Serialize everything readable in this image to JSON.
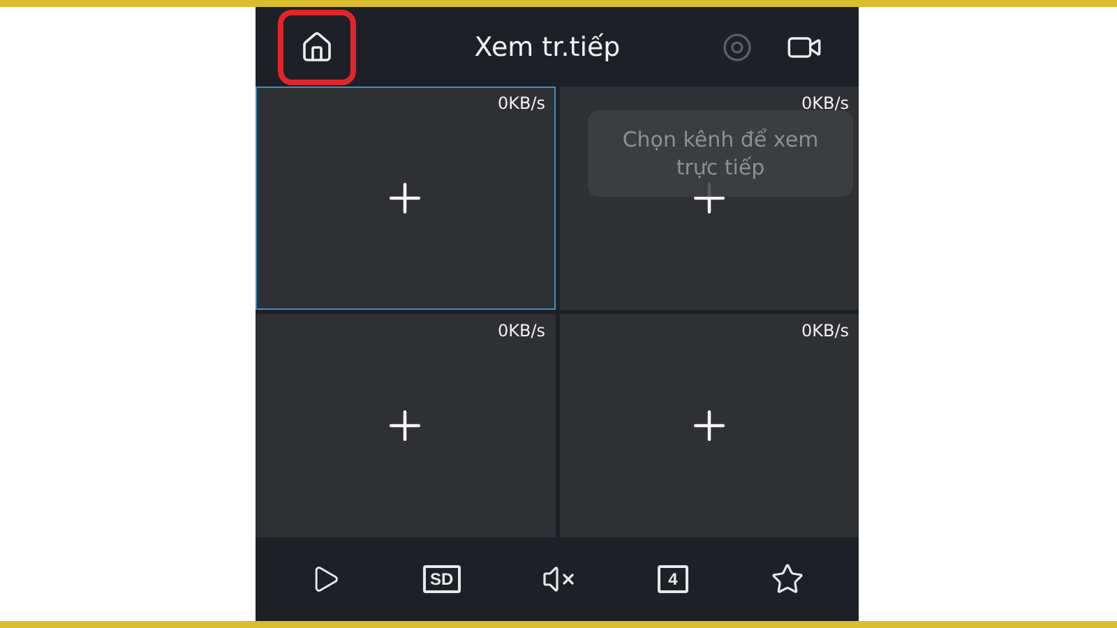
{
  "header": {
    "title": "Xem tr.tiếp",
    "home_highlighted": true
  },
  "grid": {
    "cells": [
      {
        "speed": "0KB/s",
        "selected": true
      },
      {
        "speed": "0KB/s",
        "selected": false
      },
      {
        "speed": "0KB/s",
        "selected": false
      },
      {
        "speed": "0KB/s",
        "selected": false
      }
    ]
  },
  "toast": {
    "text": "Chọn kênh để xem trực tiếp"
  },
  "toolbar": [
    {
      "kind": "play"
    },
    {
      "kind": "label",
      "text": "SD"
    },
    {
      "kind": "mute"
    },
    {
      "kind": "label",
      "text": "4"
    },
    {
      "kind": "star"
    }
  ]
}
